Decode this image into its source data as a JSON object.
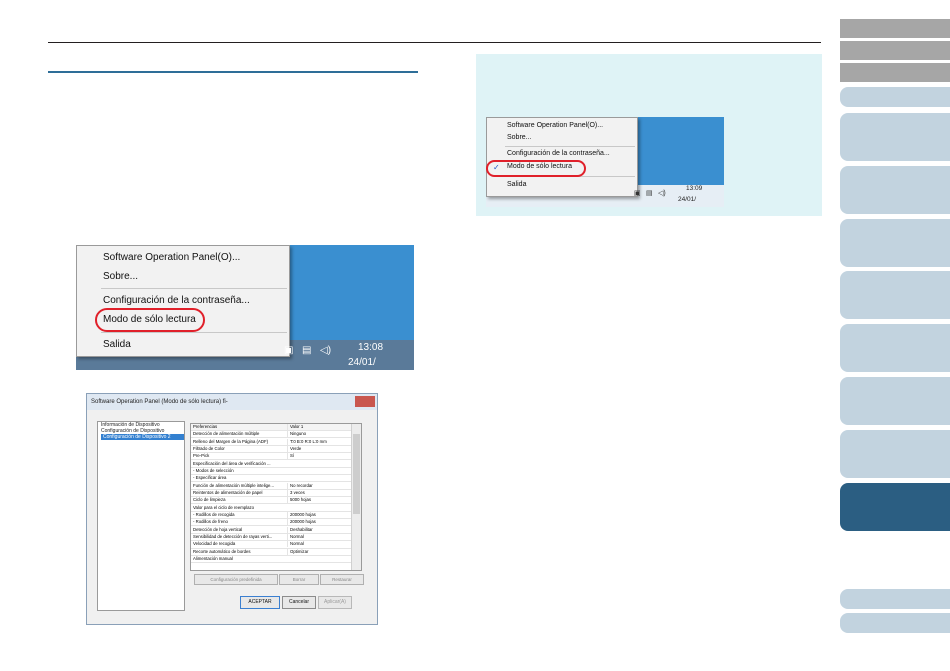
{
  "nav": {
    "tabs": [
      {
        "state": "gray"
      },
      {
        "state": "gray"
      },
      {
        "state": "gray"
      },
      {
        "state": "light"
      },
      {
        "state": "light"
      },
      {
        "state": "light"
      },
      {
        "state": "light"
      },
      {
        "state": "light"
      },
      {
        "state": "light"
      },
      {
        "state": "light"
      },
      {
        "state": "light"
      },
      {
        "state": "active"
      },
      {
        "state": "light"
      },
      {
        "state": "light"
      }
    ],
    "active_color": "#2b5e82",
    "light_color": "#c2d3df",
    "gray_color": "#a6a6a6"
  },
  "figure1": {
    "menu": {
      "item1": "Software Operation Panel(O)...",
      "item2": "Sobre...",
      "item3": "Configuración de la contraseña...",
      "item4": "Modo de sólo lectura",
      "item5": "Salida"
    },
    "clock_time": "13:08",
    "clock_date": "24/01/"
  },
  "figure2": {
    "title": "Software Operation Panel (Modo de sólo lectura) fi-",
    "tree": [
      "Información de Dispositivo",
      "Configuración de Dispositivo",
      "Configuración de Dispositivo 2"
    ],
    "grid_header": [
      "Preferencias",
      "Valor 1"
    ],
    "rows": [
      [
        "Detección de alimentación múltiple",
        "Ninguno"
      ],
      [
        "Relleno del Margen de la Página (ADF)",
        "T:0  B:0  R:0  L:0 mm"
      ],
      [
        "Filtrado de Color",
        "Verde"
      ],
      [
        "Pre-Pick",
        "Sí"
      ],
      [
        "Especificación del área de verificación ...",
        ""
      ],
      [
        "  - Modos de selección",
        ""
      ],
      [
        "  - Especificar área",
        ""
      ],
      [
        "Función de alimentación múltiple intelige...",
        "No recordar"
      ],
      [
        "Reintentos de alimentación de papel",
        "3 veces"
      ],
      [
        "Ciclo de limpieza",
        "5000 hojas"
      ],
      [
        "Valor para el ciclo de reemplazo",
        ""
      ],
      [
        "  - Rodillos de recogida",
        "200000 hojas"
      ],
      [
        "  - Rodillos de freno",
        "200000 hojas"
      ],
      [
        "Detección de hoja vertical",
        "Deshabilitar"
      ],
      [
        "Sensibilidad de detección de rayas verti...",
        "Normal"
      ],
      [
        "Velocidad de recogida",
        "Normal"
      ],
      [
        "Recorte automático de bordes",
        "Optimizar"
      ],
      [
        "Alimentación manual",
        ""
      ]
    ],
    "sub_buttons": [
      "Configuración predefinida",
      "Borrar",
      "Restaurar"
    ],
    "buttons": {
      "ok": "ACEPTAR",
      "cancel": "Cancelar",
      "apply": "Aplicar(A)"
    }
  },
  "figure3": {
    "menu": {
      "item1": "Software Operation Panel(O)...",
      "item2": "Sobre...",
      "item3": "Configuración de la contraseña...",
      "item4": "Modo de sólo lectura",
      "item5": "Salida",
      "check": "✓"
    },
    "clock_time": "13:09",
    "clock_date": "24/01/"
  }
}
